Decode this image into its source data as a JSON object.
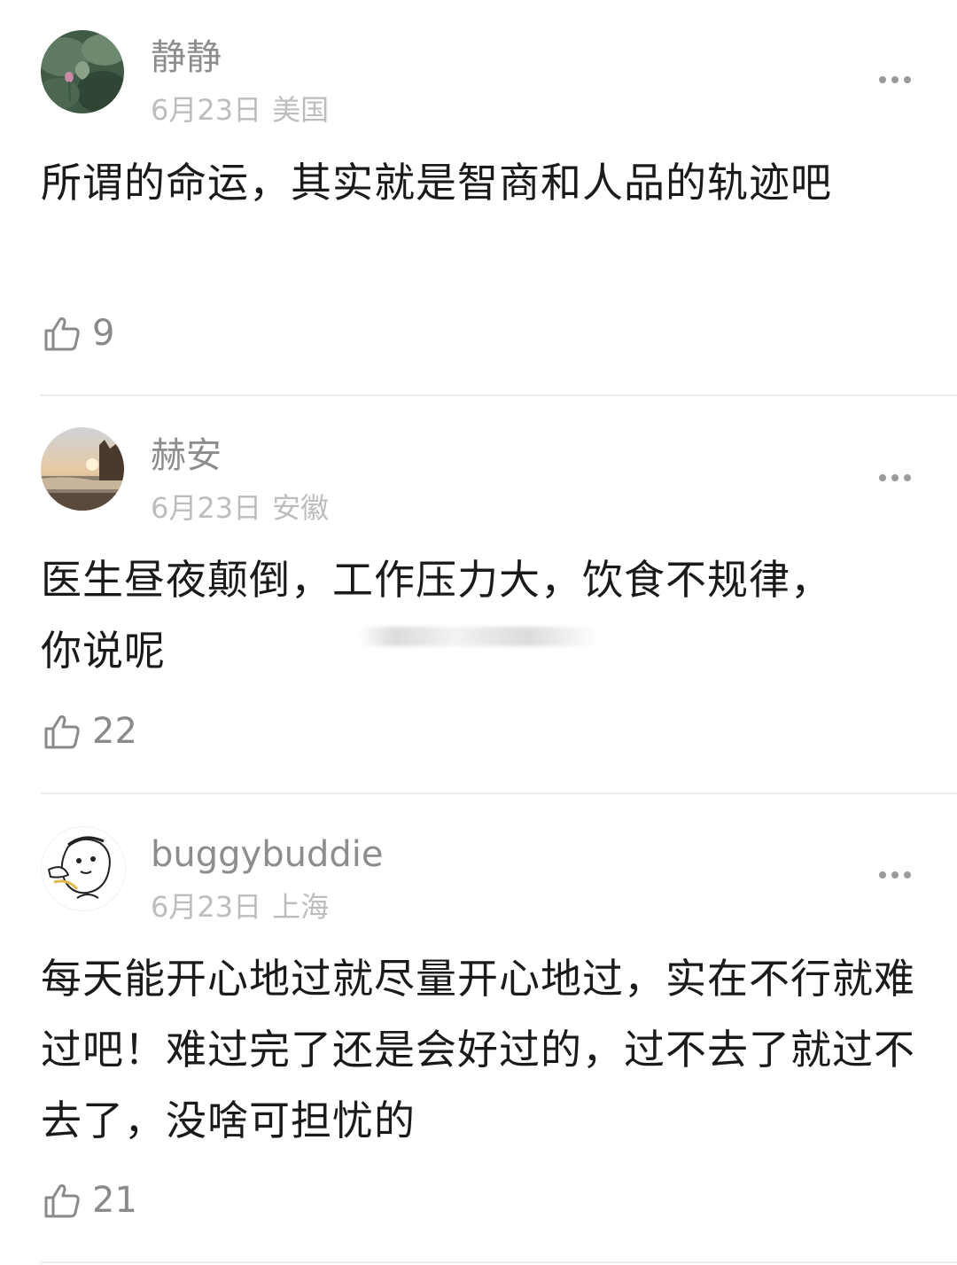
{
  "comments": [
    {
      "username": "静静",
      "date": "6月23日",
      "location": "美国",
      "text": "所谓的命运，其实就是智商和人品的轨迹吧",
      "likes": "9",
      "avatar_icon": "lotus-photo-avatar"
    },
    {
      "username": "赫安",
      "date": "6月23日",
      "location": "安徽",
      "text": "医生昼夜颠倒，工作压力大，饮食不规律，你说呢",
      "likes": "22",
      "avatar_icon": "sunset-photo-avatar"
    },
    {
      "username": "buggybuddie",
      "date": "6月23日",
      "location": "上海",
      "text": "每天能开心地过就尽量开心地过，实在不行就难过吧！难过完了还是会好过的，过不去了就过不去了，没啥可担忧的",
      "likes": "21",
      "avatar_icon": "cartoon-doodle-avatar"
    }
  ],
  "icons": {
    "like": "thumbs-up-icon",
    "more": "more-dots-icon"
  },
  "colors": {
    "username": "#8d8d8d",
    "meta": "#bdbdbd",
    "body_text": "#1a1a1a",
    "divider": "#ececec"
  }
}
